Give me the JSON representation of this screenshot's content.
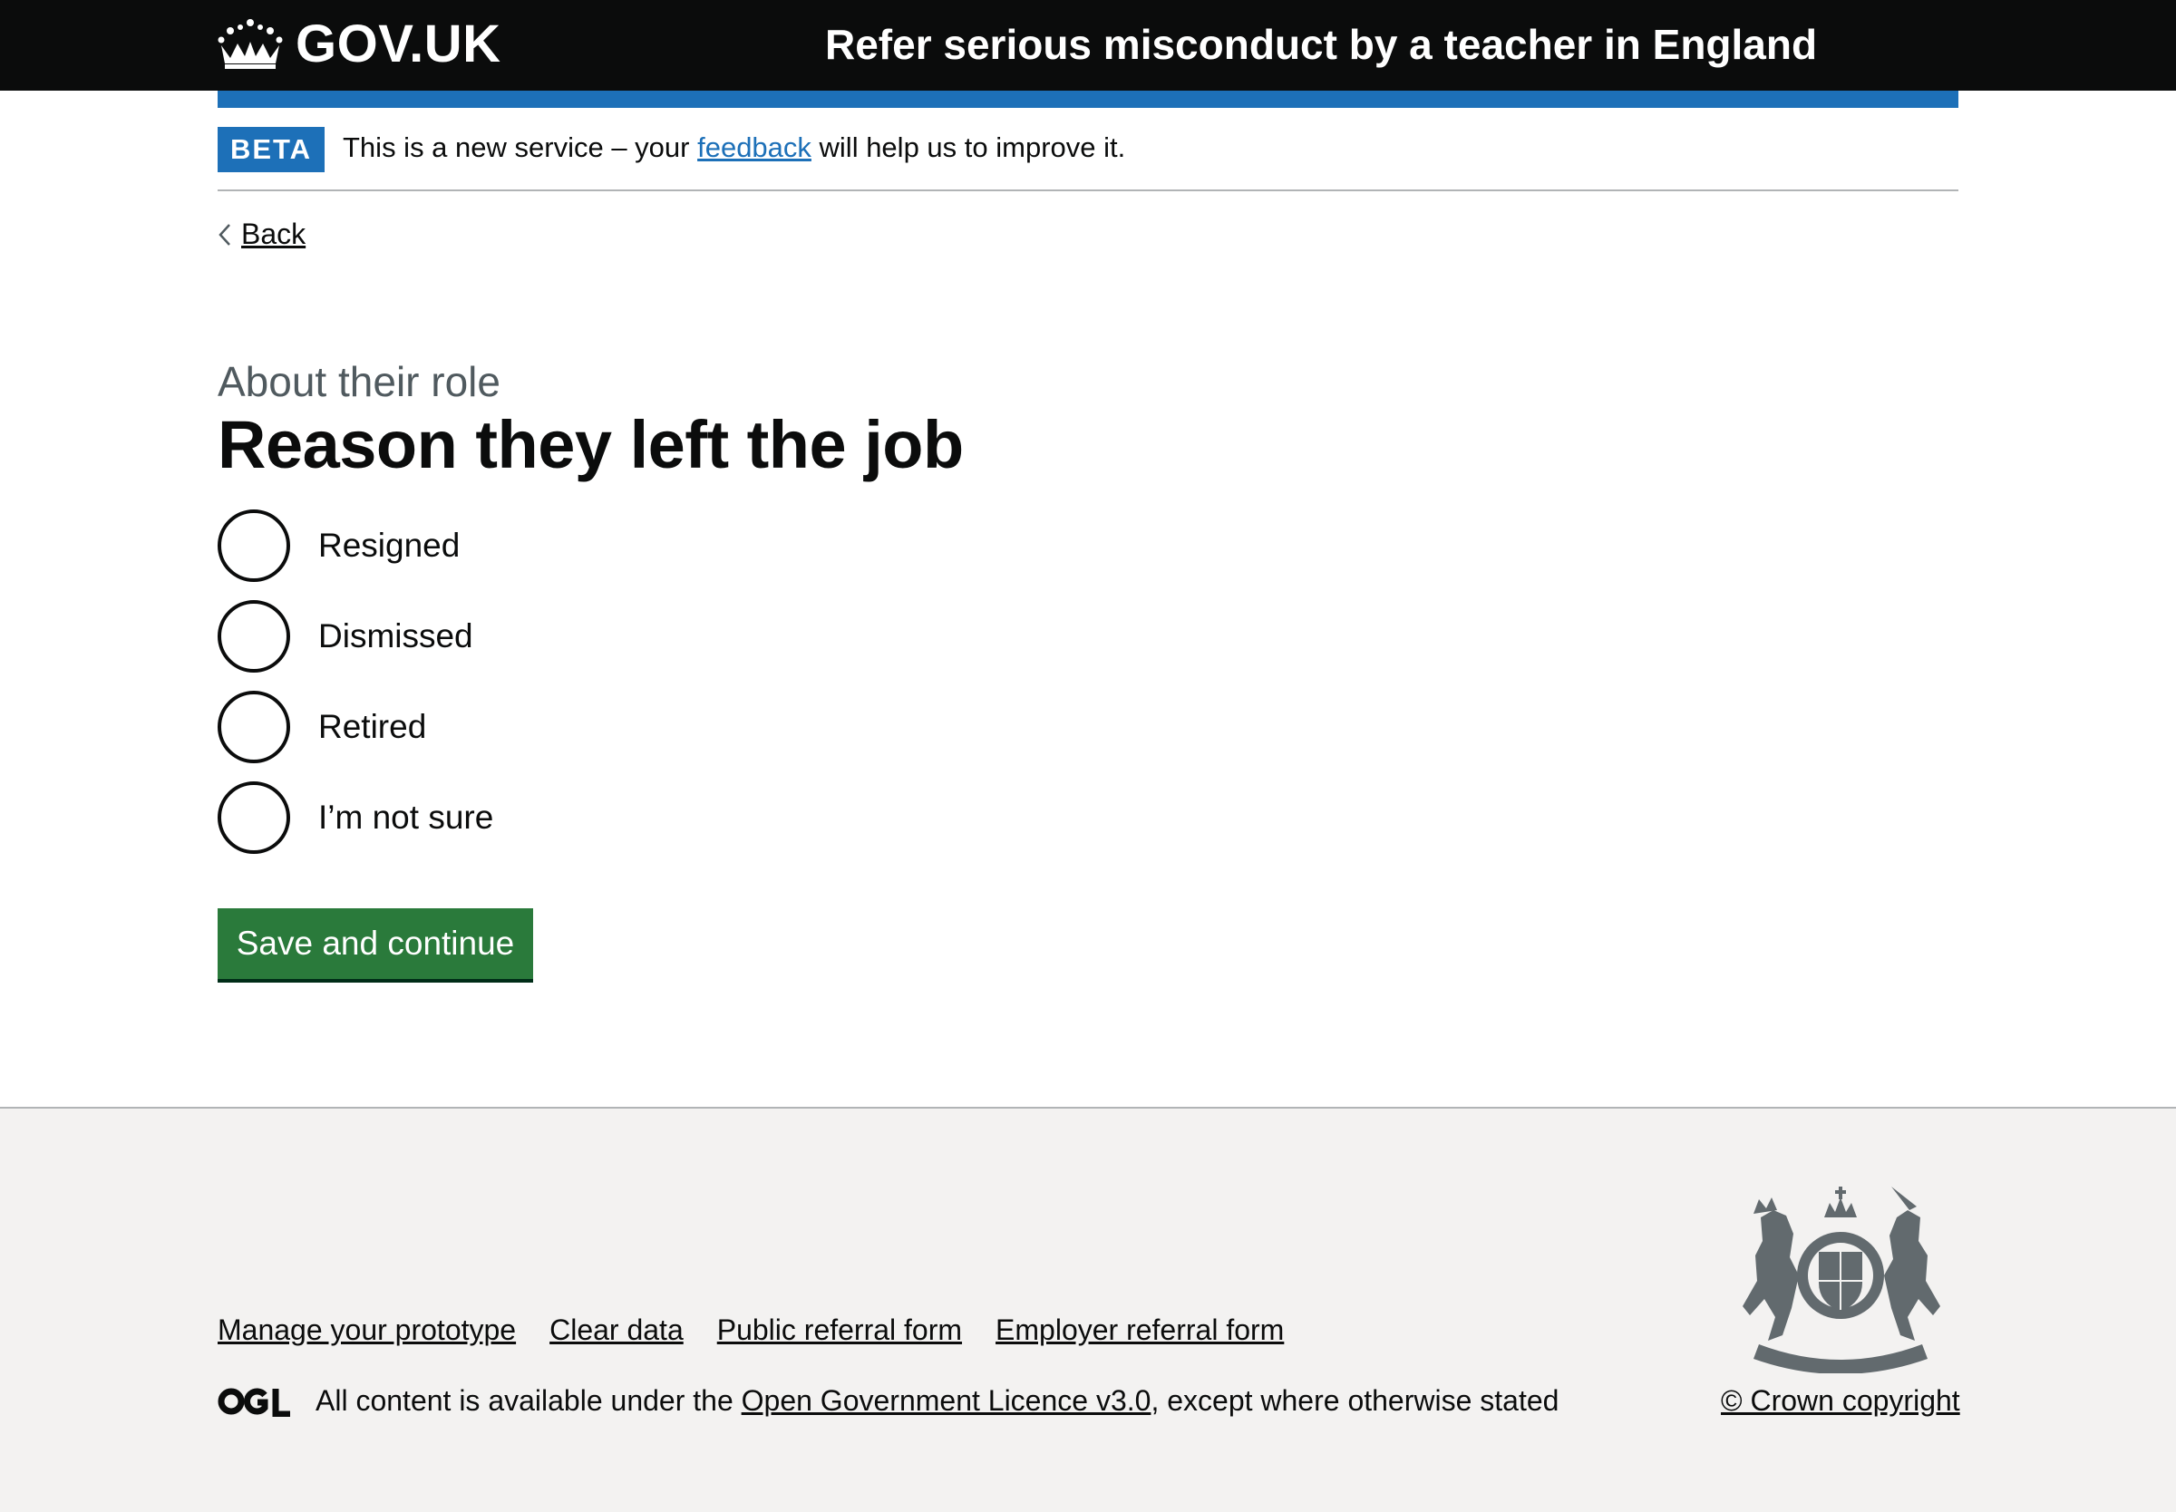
{
  "header": {
    "logo_text": "GOV.UK",
    "service_name": "Refer serious misconduct by a teacher in England"
  },
  "phase_banner": {
    "tag": "BETA",
    "text_before": "This is a new service – your ",
    "link": "feedback",
    "text_after": " will help us to improve it."
  },
  "back_link": "Back",
  "main": {
    "caption": "About their role",
    "heading": "Reason they left the job",
    "options": [
      {
        "label": "Resigned",
        "checked": false
      },
      {
        "label": "Dismissed",
        "checked": false
      },
      {
        "label": "Retired",
        "checked": false
      },
      {
        "label": "I’m not sure",
        "checked": false
      }
    ],
    "button": "Save and continue"
  },
  "footer": {
    "links": [
      "Manage your prototype",
      "Clear data",
      "Public referral form",
      "Employer referral form"
    ],
    "licence_before": "All content is available under the ",
    "licence_link": "Open Government Licence v3.0",
    "licence_after": ", except where otherwise stated",
    "copyright": "© Crown copyright"
  },
  "colors": {
    "header_bg": "#0b0c0c",
    "brand_blue": "#1d70b8",
    "button_green": "#2a7a3b",
    "footer_bg": "#f3f2f1",
    "caption_grey": "#505a5f"
  }
}
